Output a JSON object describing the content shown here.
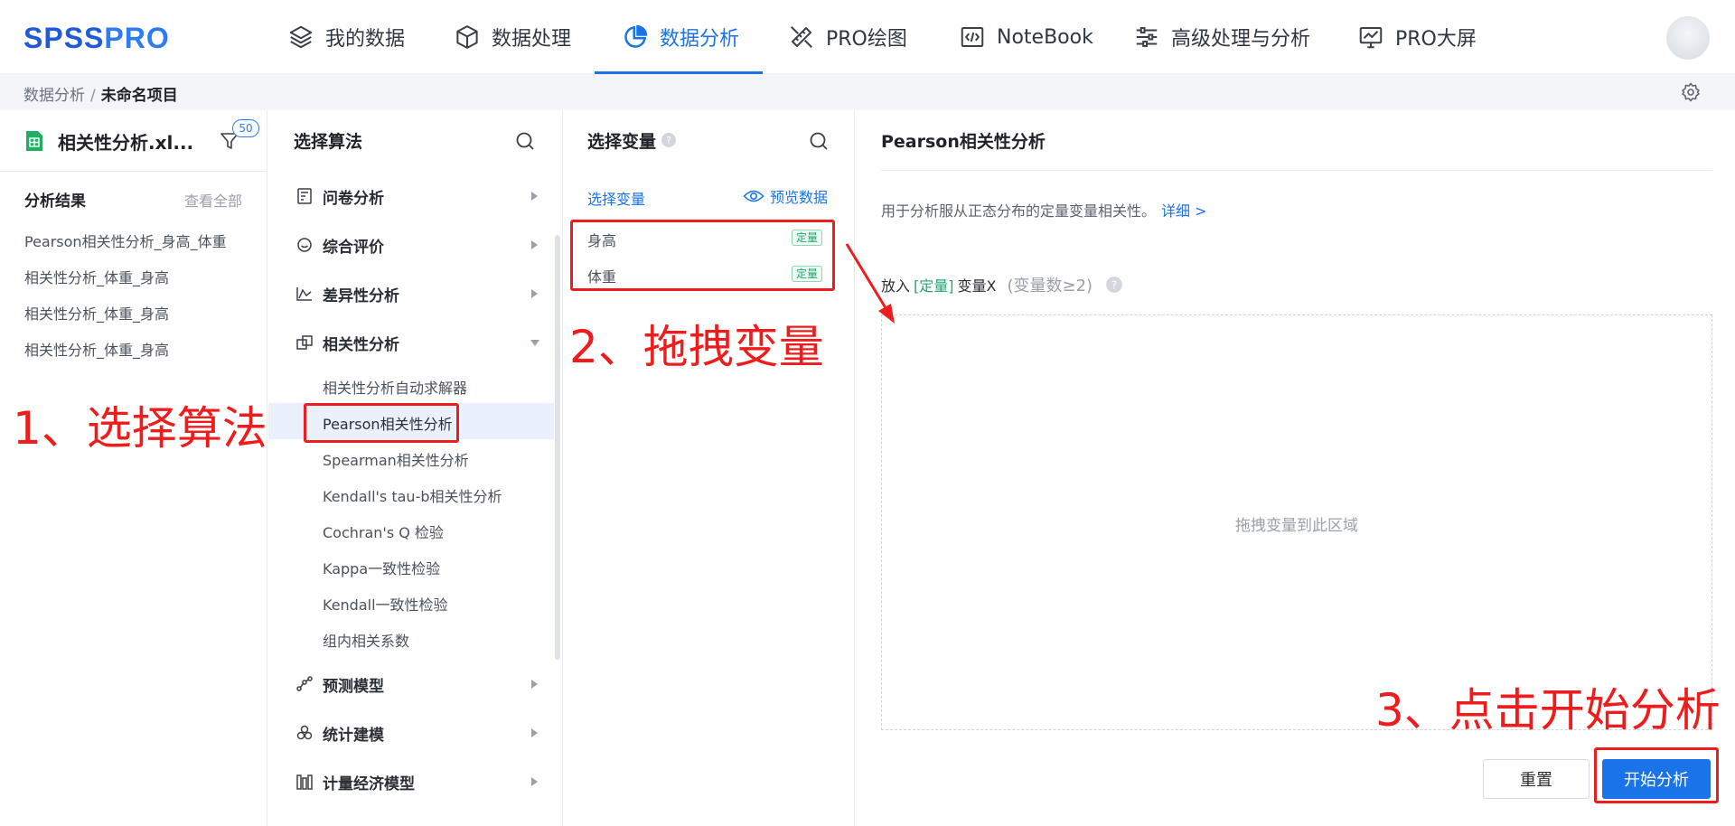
{
  "brand": {
    "logo_main": "SPSS",
    "logo_accent": "PRO"
  },
  "nav": {
    "items": [
      {
        "label": "我的数据",
        "icon": "layers-icon"
      },
      {
        "label": "数据处理",
        "icon": "cube-icon"
      },
      {
        "label": "数据分析",
        "icon": "pie-chart-icon",
        "active": true
      },
      {
        "label": "PRO绘图",
        "icon": "ruler-pencil-icon"
      },
      {
        "label": "NoteBook",
        "icon": "code-icon"
      },
      {
        "label": "高级处理与分析",
        "icon": "sliders-icon"
      },
      {
        "label": "PRO大屏",
        "icon": "dashboard-icon"
      }
    ]
  },
  "breadcrumb": {
    "root": "数据分析",
    "sep": "/",
    "current": "未命名项目"
  },
  "file": {
    "name": "相关性分析.xl...",
    "filter_count": "50"
  },
  "results": {
    "title": "分析结果",
    "view_all": "查看全部",
    "items": [
      "Pearson相关性分析_身高_体重",
      "相关性分析_体重_身高",
      "相关性分析_体重_身高",
      "相关性分析_体重_身高"
    ]
  },
  "algorithms": {
    "title": "选择算法",
    "categories": [
      {
        "label": "问卷分析",
        "icon": "questionnaire-icon"
      },
      {
        "label": "综合评价",
        "icon": "chat-bubble-icon"
      },
      {
        "label": "差异性分析",
        "icon": "line-chart-icon"
      },
      {
        "label": "相关性分析",
        "icon": "correlation-icon"
      },
      {
        "label": "预测模型",
        "icon": "nodes-icon"
      },
      {
        "label": "统计建模",
        "icon": "circles-icon"
      },
      {
        "label": "计量经济模型",
        "icon": "columns-icon"
      }
    ],
    "sub_items": [
      "相关性分析自动求解器",
      "Pearson相关性分析",
      "Spearman相关性分析",
      "Kendall's tau-b相关性分析",
      "Cochran's Q 检验",
      "Kappa一致性检验",
      "Kendall一致性检验",
      "组内相关系数"
    ]
  },
  "variables": {
    "title": "选择变量",
    "tab": "选择变量",
    "preview": "预览数据",
    "items": [
      {
        "name": "身高",
        "tag": "定量"
      },
      {
        "name": "体重",
        "tag": "定量"
      }
    ]
  },
  "method": {
    "title": "Pearson相关性分析",
    "description": "用于分析服从正态分布的定量变量相关性。",
    "more": "详细 >",
    "drop_prefix": "放入",
    "drop_type": "[定量]",
    "drop_var": "变量X",
    "drop_count": "(变量数≥2)",
    "drop_hint": "拖拽变量到此区域",
    "reset": "重置",
    "start": "开始分析"
  },
  "annotations": {
    "step1": "1、选择算法",
    "step2": "2、拖拽变量",
    "step3": "3、点击开始分析"
  },
  "colors": {
    "accent": "#1a73e8",
    "annotation": "#ee1d1d",
    "quant_tag": "#23a86b"
  }
}
